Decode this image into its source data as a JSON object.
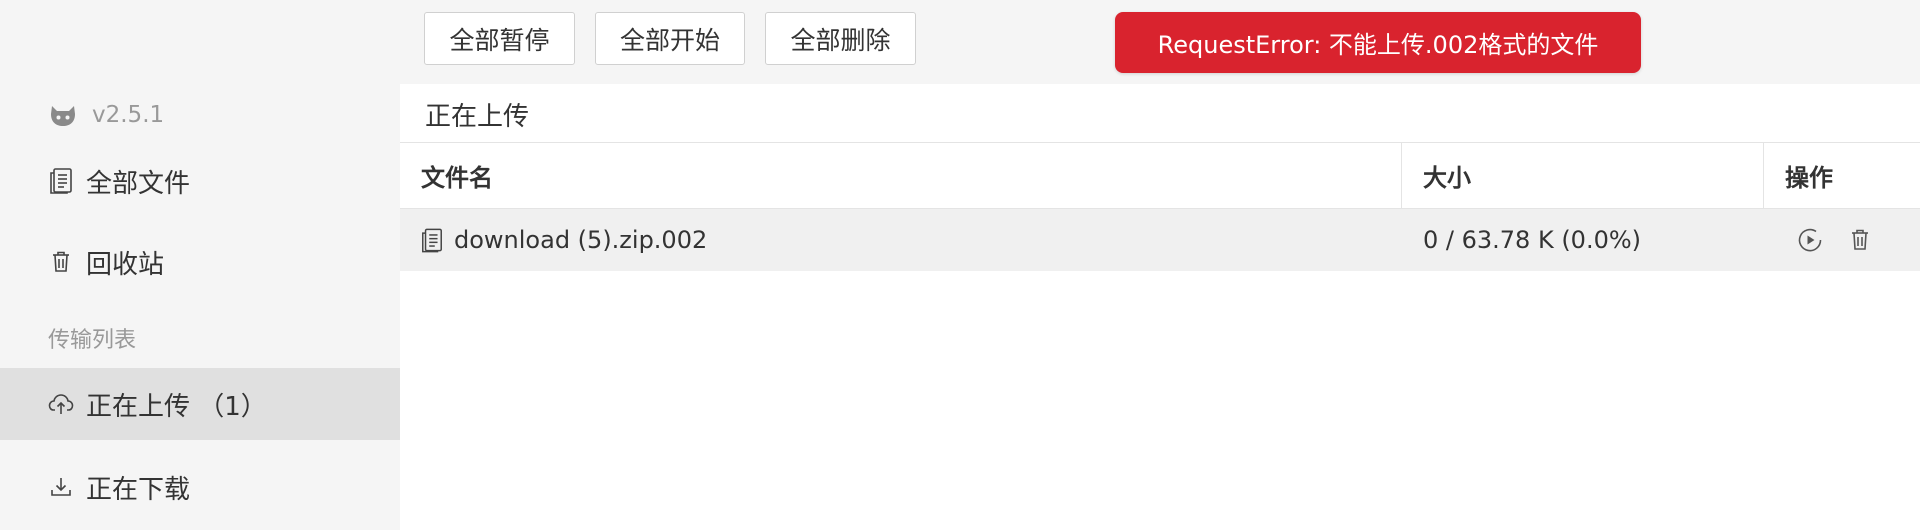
{
  "sidebar": {
    "version": "v2.5.1",
    "items": [
      {
        "label": "全部文件",
        "icon": "document-icon"
      },
      {
        "label": "回收站",
        "icon": "trash-icon"
      }
    ],
    "section_label": "传输列表",
    "transfer_items": [
      {
        "label": "正在上传  （1）",
        "icon": "cloud-upload-icon",
        "active": true
      },
      {
        "label": "正在下载",
        "icon": "download-icon",
        "active": false
      }
    ]
  },
  "toolbar": {
    "pause_all": "全部暂停",
    "start_all": "全部开始",
    "delete_all": "全部删除"
  },
  "toast": {
    "message": "RequestError: 不能上传.002格式的文件",
    "color": "#d9232e"
  },
  "main": {
    "title": "正在上传"
  },
  "table": {
    "headers": [
      "文件名",
      "大小",
      "操作"
    ],
    "rows": [
      {
        "name": "download (5).zip.002",
        "size": "0 / 63.78 K (0.0%)"
      }
    ]
  }
}
